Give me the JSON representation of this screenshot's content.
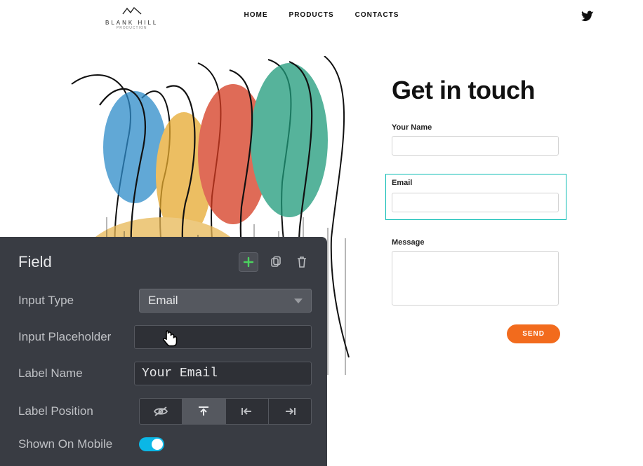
{
  "brand": {
    "name": "BLANK HILL",
    "sub": "PRODUCTION"
  },
  "nav": {
    "home": "HOME",
    "products": "PRODUCTS",
    "contacts": "CONTACTS"
  },
  "contact": {
    "heading": "Get in touch",
    "name_label": "Your Name",
    "email_label": "Email",
    "message_label": "Message",
    "send": "SEND"
  },
  "panel": {
    "title": "Field",
    "rows": {
      "input_type_label": "Input Type",
      "input_type_value": "Email",
      "placeholder_label": "Input Placeholder",
      "placeholder_value": "",
      "label_name_label": "Label Name",
      "label_name_value": "Your Email",
      "label_position_label": "Label Position",
      "shown_mobile_label": "Shown On Mobile"
    }
  }
}
